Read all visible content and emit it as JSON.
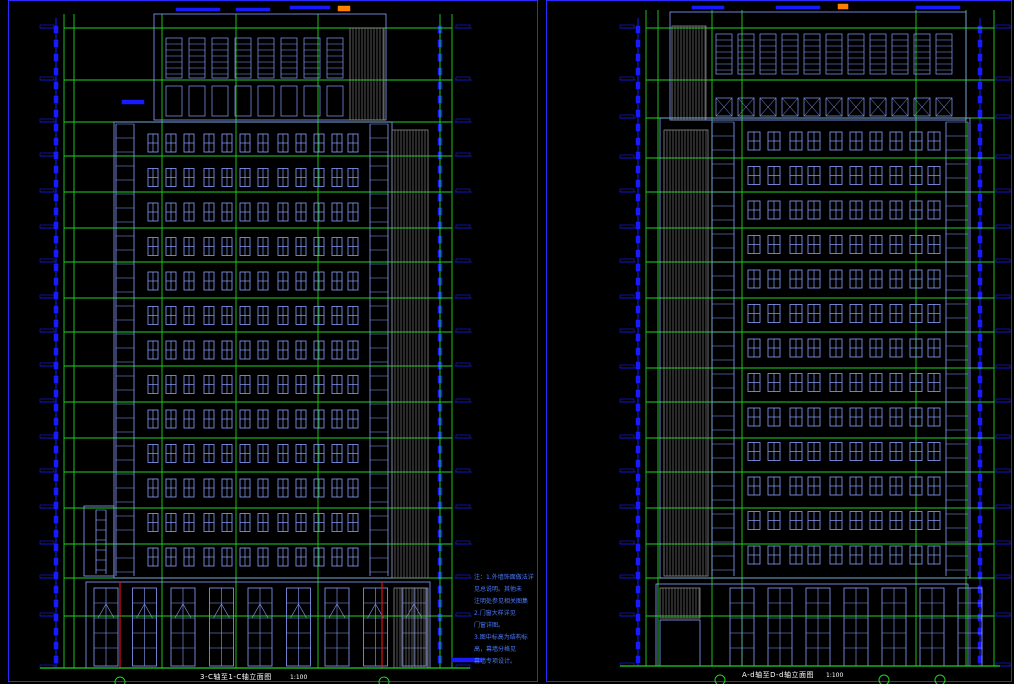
{
  "drawing": {
    "left_elevation": {
      "caption": "3-C轴至1-C轴立面图",
      "scale": "1:100",
      "floors_typical": 13
    },
    "right_elevation": {
      "caption": "A-d轴至D-d轴立面图",
      "scale": "1:100",
      "floors_typical": 13
    },
    "notes": {
      "lines": [
        "注：1.外墙饰面做法详",
        "见总说明。其他未",
        "注明处参见相关图集",
        "2.门窗大样详见",
        "门窗详图。",
        "3.图中标高为结构标",
        "高，幕墙分格见",
        "幕墙专项设计。"
      ]
    },
    "colors": {
      "background": "#000000",
      "grid_green": "#1fd21f",
      "window_blue": "#8aa0ff",
      "dim_blue": "#1a1aff",
      "frame_blue": "#2a2aff",
      "cladding_grey": "#8a8a8a",
      "accent_red": "#e01010",
      "accent_orange": "#ff8000"
    }
  }
}
